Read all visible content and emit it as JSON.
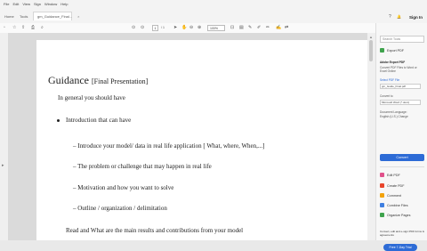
{
  "menu": [
    "File",
    "Edit",
    "View",
    "Sign",
    "Window",
    "Help"
  ],
  "tabs": {
    "home": "Home",
    "tools": "Tools",
    "document": "gm_Guidance_Final...",
    "close": "×"
  },
  "header_icons": {
    "help": "?",
    "bell": "🔔",
    "sign_in": "Sign In"
  },
  "toolbar": {
    "page_current": "1",
    "page_total": "/ 1",
    "zoom": "100%"
  },
  "document": {
    "title": "Guidance",
    "subtitle": "[Final Presentation]",
    "intro": "In general you should have",
    "bullet": "Introduction that can have",
    "items": [
      "– Introduce your model/ data in real life application [ What, where, When,...]",
      "– The problem or challenge that may happen in real life",
      "– Motivation and how you want to solve",
      "– Outline / organization / delimitation",
      "Read and What are the main results and contributions from your model"
    ]
  },
  "right_pane": {
    "search_placeholder": "Search Tools",
    "export_pdf": "Export PDF",
    "panel_title": "Adobe Export PDF",
    "panel_desc": "Convert PDF Files to Word or Excel Online",
    "select_label": "Select PDF File",
    "file_name": "gm_Guide_Final.pdf",
    "convert_to": "Convert to",
    "format": "Microsoft Word (*.docx)",
    "doc_language": "Document Language:",
    "language": "English (U.S.) Change",
    "convert_button": "Convert",
    "tools": [
      {
        "label": "Edit PDF",
        "color": "#e0518b"
      },
      {
        "label": "Create PDF",
        "color": "#e8452c"
      },
      {
        "label": "Comment",
        "color": "#f2a20c"
      },
      {
        "label": "Combine Files",
        "color": "#3f7fe0"
      },
      {
        "label": "Organize Pages",
        "color": "#3fa34d"
      }
    ],
    "promo": "Convert, edit and e-sign PDF forms & agreements",
    "trial_button": "Free 7-Day Trial"
  }
}
